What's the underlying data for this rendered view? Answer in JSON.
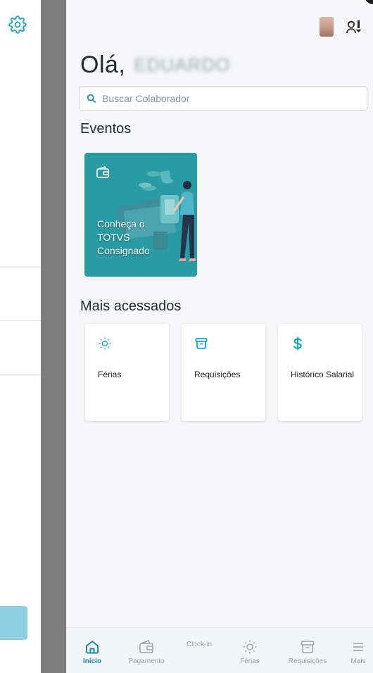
{
  "header": {
    "greeting_prefix": "Olá,",
    "user_name": "EDUARDO"
  },
  "search": {
    "placeholder": "Buscar Colaborador"
  },
  "events": {
    "title": "Eventos",
    "card_text_lines": [
      "Conheça o",
      "TOTVS",
      "Consignado"
    ]
  },
  "most_accessed": {
    "title": "Mais acessados",
    "items": [
      {
        "label": "Férias",
        "icon": "sun-icon"
      },
      {
        "label": "Requisições",
        "icon": "archive-icon"
      },
      {
        "label": "Histórico Salarial",
        "icon": "dollar-icon"
      }
    ]
  },
  "bottom_nav": {
    "items": [
      {
        "label": "Início",
        "icon": "home-icon",
        "active": true
      },
      {
        "label": "Pagamento",
        "icon": "wallet-icon",
        "active": false
      },
      {
        "label": "Clock-in",
        "icon": "clock-in",
        "active": false
      },
      {
        "label": "Férias",
        "icon": "sun-icon",
        "active": false
      },
      {
        "label": "Requisições",
        "icon": "archive-icon",
        "active": false
      },
      {
        "label": "Mais",
        "icon": "menu-icon",
        "active": false
      }
    ]
  },
  "colors": {
    "accent": "#1aa4c4",
    "event_card": "#2a9aa3",
    "separator": "#7d7d7d",
    "nav_active": "#1a8cb0"
  }
}
